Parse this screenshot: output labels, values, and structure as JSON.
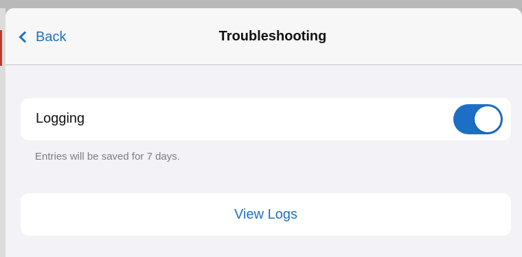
{
  "navbar": {
    "back_label": "Back",
    "title": "Troubleshooting"
  },
  "logging": {
    "label": "Logging",
    "toggle_on": true,
    "footer": "Entries will be saved for 7 days."
  },
  "view_logs": {
    "label": "View Logs"
  },
  "icons": {
    "back": "chevron-left-icon"
  },
  "colors": {
    "accent": "#1d6fc5",
    "background": "#f2f2f7",
    "cell": "#ffffff",
    "secondary_text": "#7b7b80"
  }
}
